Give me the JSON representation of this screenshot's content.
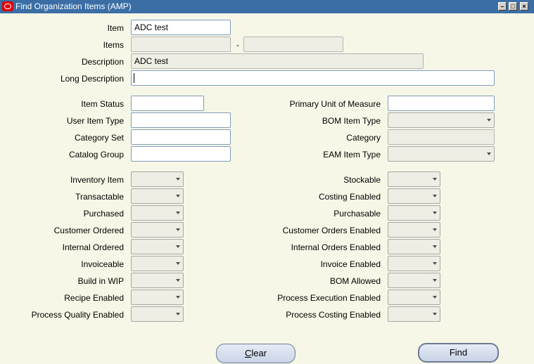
{
  "window": {
    "title": "Find Organization Items (AMP)"
  },
  "fields": {
    "item": {
      "label": "Item",
      "value": "ADC test"
    },
    "items": {
      "label": "Items",
      "separator": "-",
      "from": "",
      "to": ""
    },
    "description": {
      "label": "Description",
      "value": "ADC test"
    },
    "long_description": {
      "label": "Long Description",
      "value": ""
    },
    "item_status": {
      "label": "Item Status",
      "value": ""
    },
    "user_item_type": {
      "label": "User Item Type",
      "value": ""
    },
    "category_set": {
      "label": "Category Set",
      "value": ""
    },
    "catalog_group": {
      "label": "Catalog Group",
      "value": ""
    },
    "primary_uom": {
      "label": "Primary Unit of Measure",
      "value": ""
    },
    "bom_item_type": {
      "label": "BOM Item Type",
      "value": ""
    },
    "category": {
      "label": "Category",
      "value": ""
    },
    "eam_item_type": {
      "label": "EAM Item Type",
      "value": ""
    }
  },
  "flags_left": [
    {
      "label": "Inventory Item",
      "value": ""
    },
    {
      "label": "Transactable",
      "value": ""
    },
    {
      "label": "Purchased",
      "value": ""
    },
    {
      "label": "Customer Ordered",
      "value": ""
    },
    {
      "label": "Internal Ordered",
      "value": ""
    },
    {
      "label": "Invoiceable",
      "value": ""
    },
    {
      "label": "Build in WIP",
      "value": ""
    },
    {
      "label": "Recipe Enabled",
      "value": ""
    },
    {
      "label": "Process Quality Enabled",
      "value": ""
    }
  ],
  "flags_right": [
    {
      "label": "Stockable",
      "value": ""
    },
    {
      "label": "Costing Enabled",
      "value": ""
    },
    {
      "label": "Purchasable",
      "value": ""
    },
    {
      "label": "Customer Orders Enabled",
      "value": ""
    },
    {
      "label": "Internal Orders Enabled",
      "value": ""
    },
    {
      "label": "Invoice Enabled",
      "value": ""
    },
    {
      "label": "BOM Allowed",
      "value": ""
    },
    {
      "label": "Process Execution Enabled",
      "value": ""
    },
    {
      "label": "Process Costing Enabled",
      "value": ""
    }
  ],
  "buttons": {
    "clear_prefix": "C",
    "clear_rest": "lear",
    "find": "Find"
  },
  "icons": {
    "app": "oracle-logo-icon",
    "minimize": "minimize-icon",
    "maximize": "maximize-icon",
    "close": "close-icon"
  }
}
